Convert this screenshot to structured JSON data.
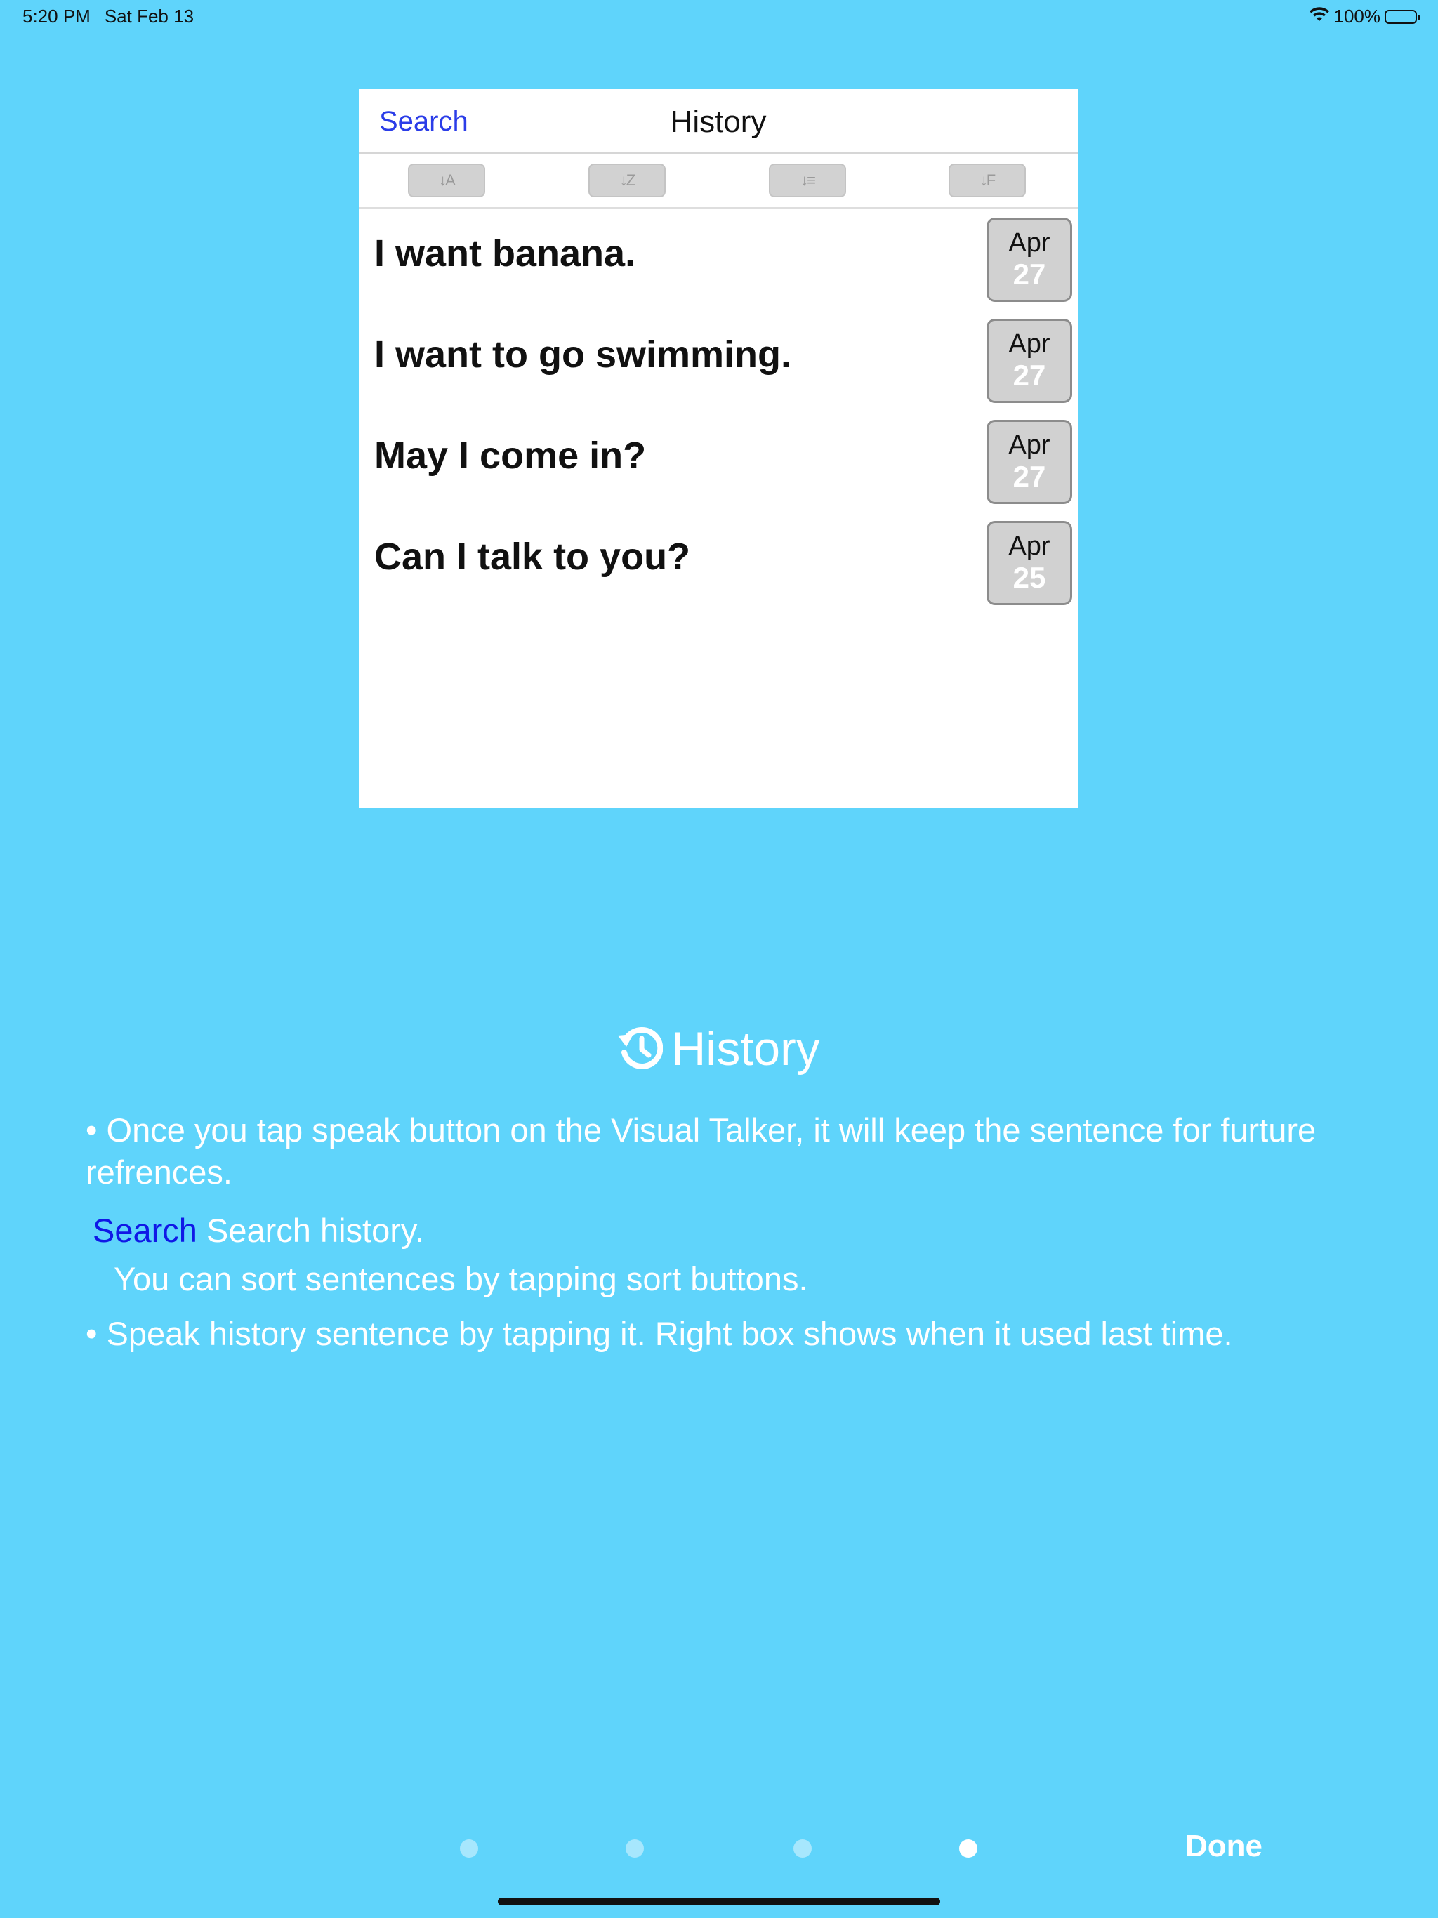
{
  "status_bar": {
    "time": "5:20 PM",
    "date": "Sat Feb 13",
    "battery": "100%",
    "icons": [
      "wifi-icon",
      "battery-icon"
    ]
  },
  "preview": {
    "search_label": "Search",
    "title": "History",
    "sort_buttons": [
      {
        "icon": "sort-alpha-ascending-icon",
        "glyph": "↓A"
      },
      {
        "icon": "sort-alpha-descending-icon",
        "glyph": "↓Z"
      },
      {
        "icon": "sort-count-ascending-icon",
        "glyph": "↓≡"
      },
      {
        "icon": "sort-date-descending-icon",
        "glyph": "↓F"
      }
    ],
    "rows": [
      {
        "text": "I want banana.",
        "month": "Apr",
        "day": "27"
      },
      {
        "text": "I want to go swimming.",
        "month": "Apr",
        "day": "27"
      },
      {
        "text": "May I come in?",
        "month": "Apr",
        "day": "27"
      },
      {
        "text": "Can I talk to you?",
        "month": "Apr",
        "day": "25"
      }
    ]
  },
  "description": {
    "heading": "History",
    "heading_icon": "history-clock-icon",
    "bullet1": "• Once you tap speak button on the Visual Talker, it will keep the sentence for furture refrences.",
    "search_word": "Search",
    "search_text": " Search history.",
    "sort_text": "You can sort sentences by tapping sort buttons.",
    "bullet2": "• Speak history sentence by tapping it. Right box shows when it used last time."
  },
  "pager": {
    "page_count": 4,
    "current_page": 4,
    "done_label": "Done"
  },
  "colors": {
    "background": "#5fd4fb",
    "search_link": "#2b3de8",
    "search_word": "#1018e6"
  }
}
